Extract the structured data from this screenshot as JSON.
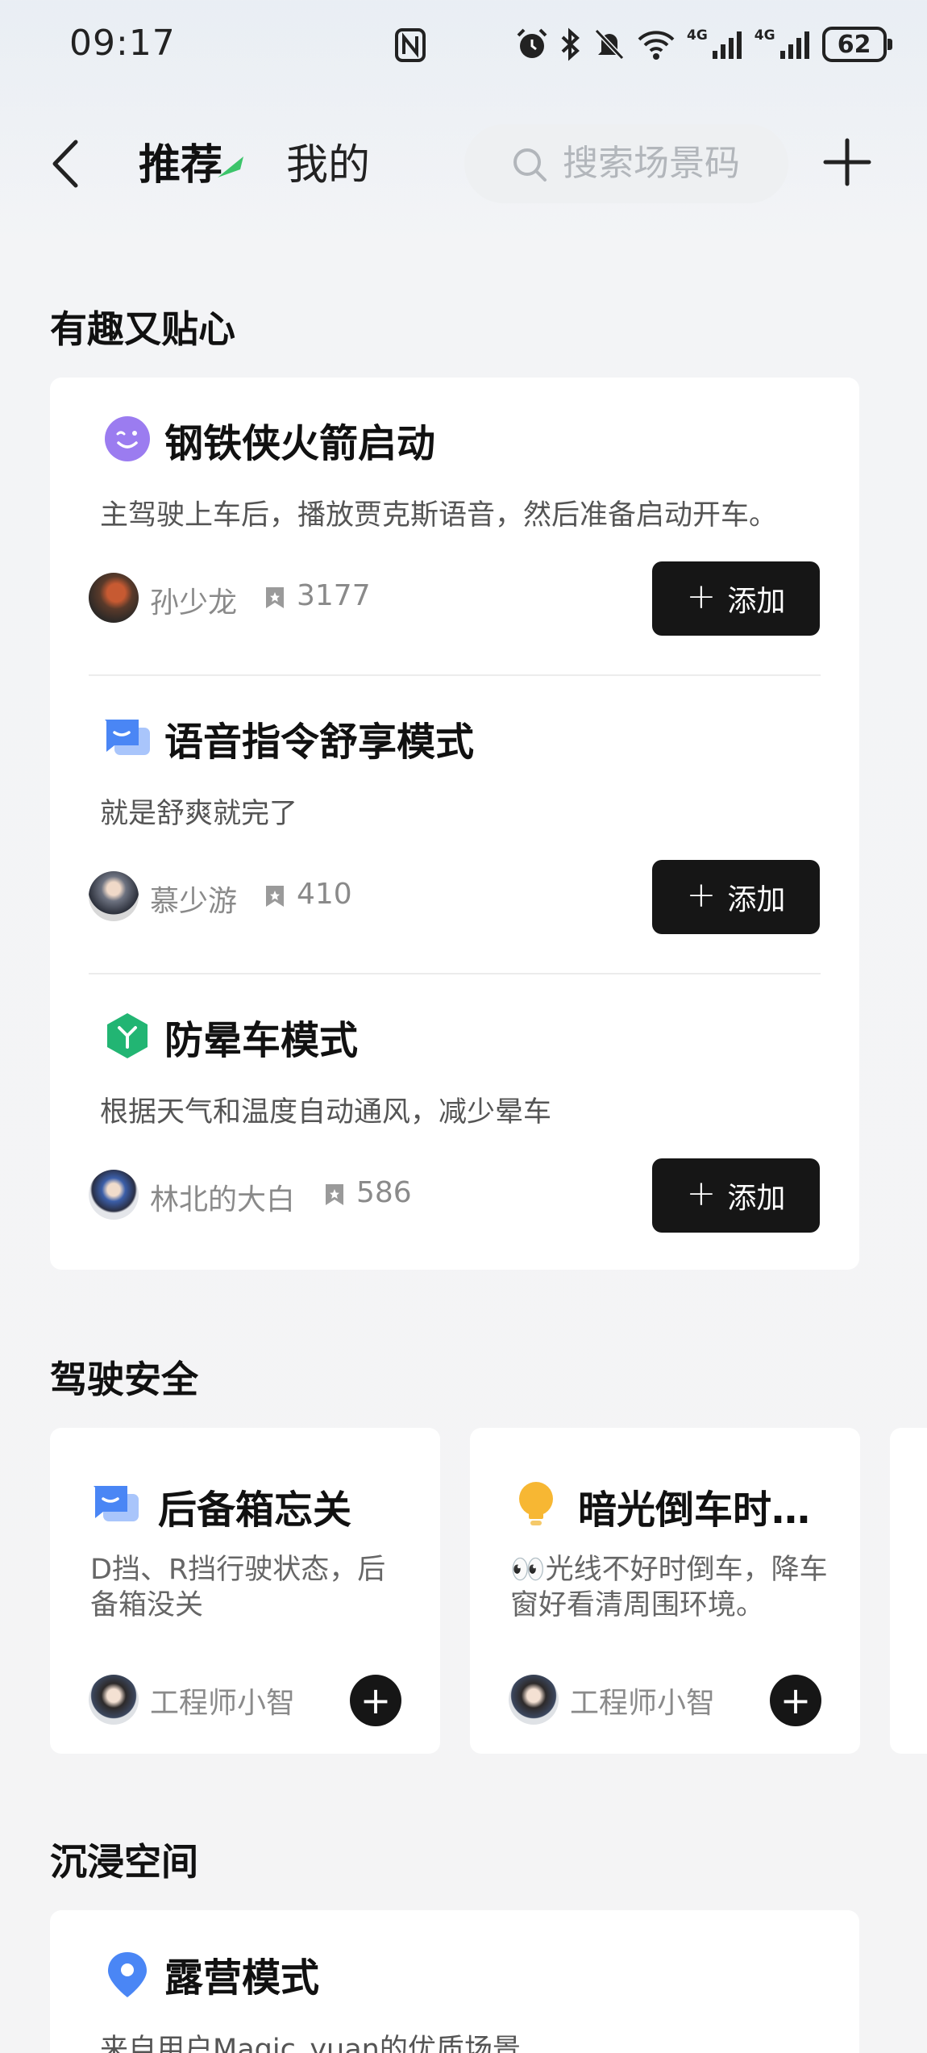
{
  "status_bar": {
    "time": "09:17",
    "battery": "62",
    "network_1": "4G",
    "network_2": "4G",
    "icons": [
      "nfc-icon",
      "alarm-icon",
      "bluetooth-icon",
      "mute-icon",
      "wifi-icon",
      "signal-icon",
      "signal-icon",
      "battery-icon"
    ]
  },
  "header": {
    "tabs": [
      {
        "label": "推荐",
        "active": true
      },
      {
        "label": "我的",
        "active": false
      }
    ],
    "search_placeholder": "搜索场景码",
    "accent_color": "#3cc46a"
  },
  "sections": [
    {
      "title": "有趣又贴心",
      "items": [
        {
          "title": "钢铁侠火箭启动",
          "icon": "smile-wink-icon",
          "icon_color": "#9b7cf0",
          "desc": "主驾驶上车后，播放贾克斯语音，然后准备启动开车。",
          "author": "孙少龙",
          "favorites": "3177",
          "button": "添加"
        },
        {
          "title": "语音指令舒享模式",
          "icon": "chat-bubble-icon",
          "icon_color": "#4a86f5",
          "desc": "就是舒爽就完了",
          "author": "慕少游",
          "favorites": "410",
          "button": "添加"
        },
        {
          "title": "防晕车模式",
          "icon": "hexagon-y-icon",
          "icon_color": "#22b573",
          "desc": "根据天气和温度自动通风，减少晕车",
          "author": "林北的大白",
          "favorites": "586",
          "button": "添加"
        }
      ]
    },
    {
      "title": "驾驶安全",
      "items": [
        {
          "title": "后备箱忘关",
          "icon": "chat-bubble-icon",
          "icon_color": "#4a86f5",
          "desc": "D挡、R挡行驶状态，后备箱没关",
          "author": "工程师小智"
        },
        {
          "title": "暗光倒车时…",
          "icon": "lightbulb-icon",
          "icon_color": "#f7b733",
          "desc": "👀光线不好时倒车，降车窗好看清周围环境。",
          "author": "工程师小智"
        }
      ]
    },
    {
      "title": "沉浸空间",
      "items": [
        {
          "title": "露营模式",
          "icon": "location-pin-icon",
          "icon_color": "#4a86f5",
          "desc": "来自用户Magic_yuan的优质场景"
        }
      ]
    }
  ]
}
